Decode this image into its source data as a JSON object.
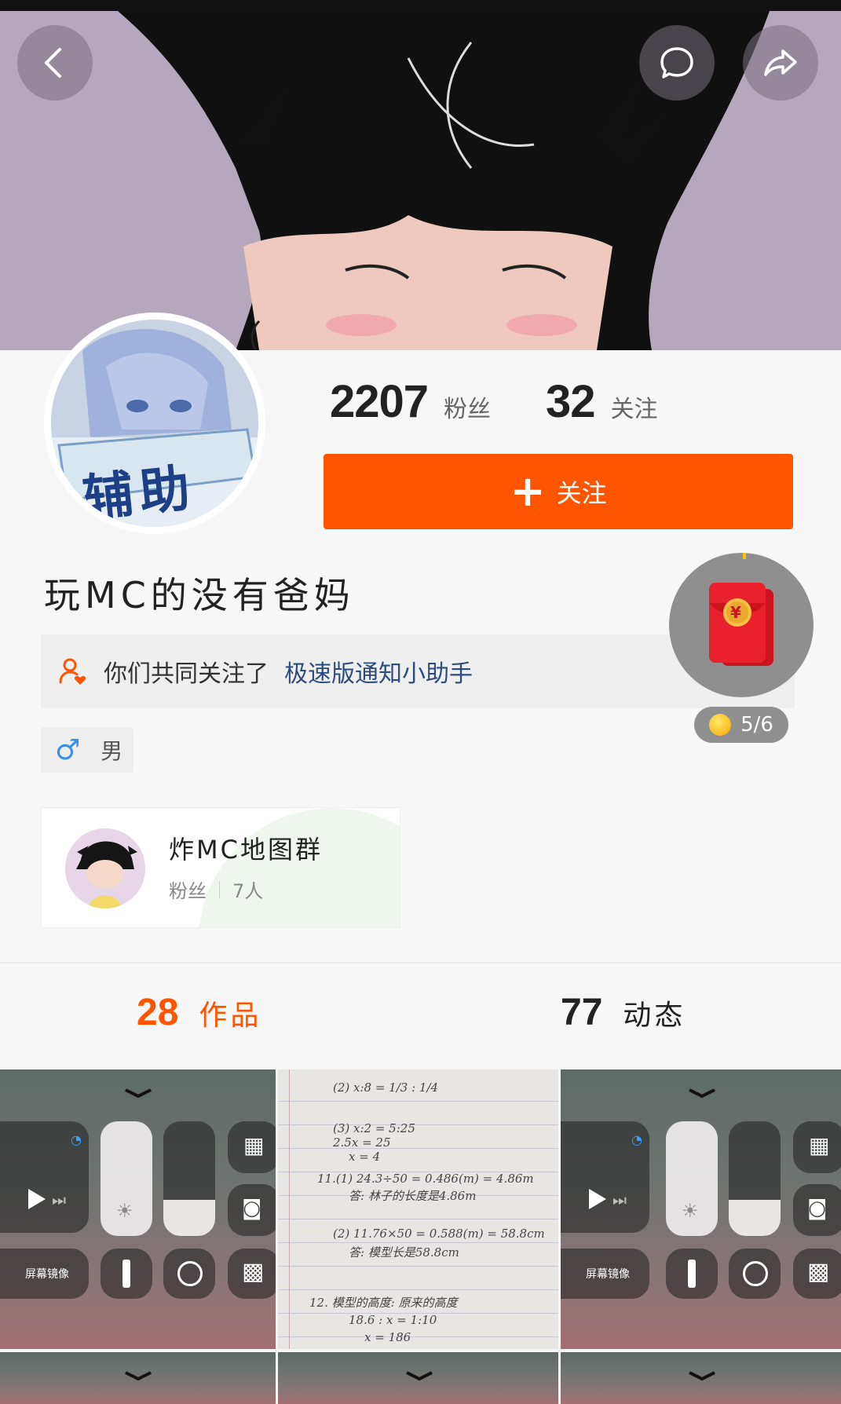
{
  "header": {
    "back_icon": "chevron-left-icon",
    "message_icon": "chat-bubble-icon",
    "share_icon": "share-arrow-icon"
  },
  "profile": {
    "fans_count": "2207",
    "fans_label": "粉丝",
    "following_count": "32",
    "following_label": "关注",
    "follow_button_label": "关注",
    "avatar_text": "辅助",
    "username": "玩MC的没有爸妈",
    "mutual_prefix": "你们共同关注了",
    "mutual_link": "极速版通知小助手",
    "gender": "男"
  },
  "red_packet": {
    "symbol": "¥",
    "progress_text": "5/6"
  },
  "group": {
    "name": "炸MC地图群",
    "fans_label": "粉丝",
    "members": "7人"
  },
  "tabs": [
    {
      "count": "28",
      "label": "作品"
    },
    {
      "count": "77",
      "label": "动态"
    }
  ],
  "thumbnails": {
    "screen_mirror_label": "屏幕镜像",
    "notes": [
      "(2) x:8 = 1/3 : 1/4",
      "(3) x:2 = 5:25",
      "2.5x = 25",
      "x = 4",
      "11.(1) 24.3÷50 = 0.486(m) = 4.86m",
      "答: 林子的长度是4.86m",
      "(2) 11.76×50 = 0.588(m) = 58.8cm",
      "答: 模型长是58.8cm",
      "12. 模型的高度: 原来的高度",
      "18.6 : x = 1:10",
      "x = 186"
    ]
  },
  "colors": {
    "accent": "#ff5500",
    "link": "#2b4c7e",
    "gender_icon": "#3b8fe8",
    "banner": "#b6a9bd"
  }
}
